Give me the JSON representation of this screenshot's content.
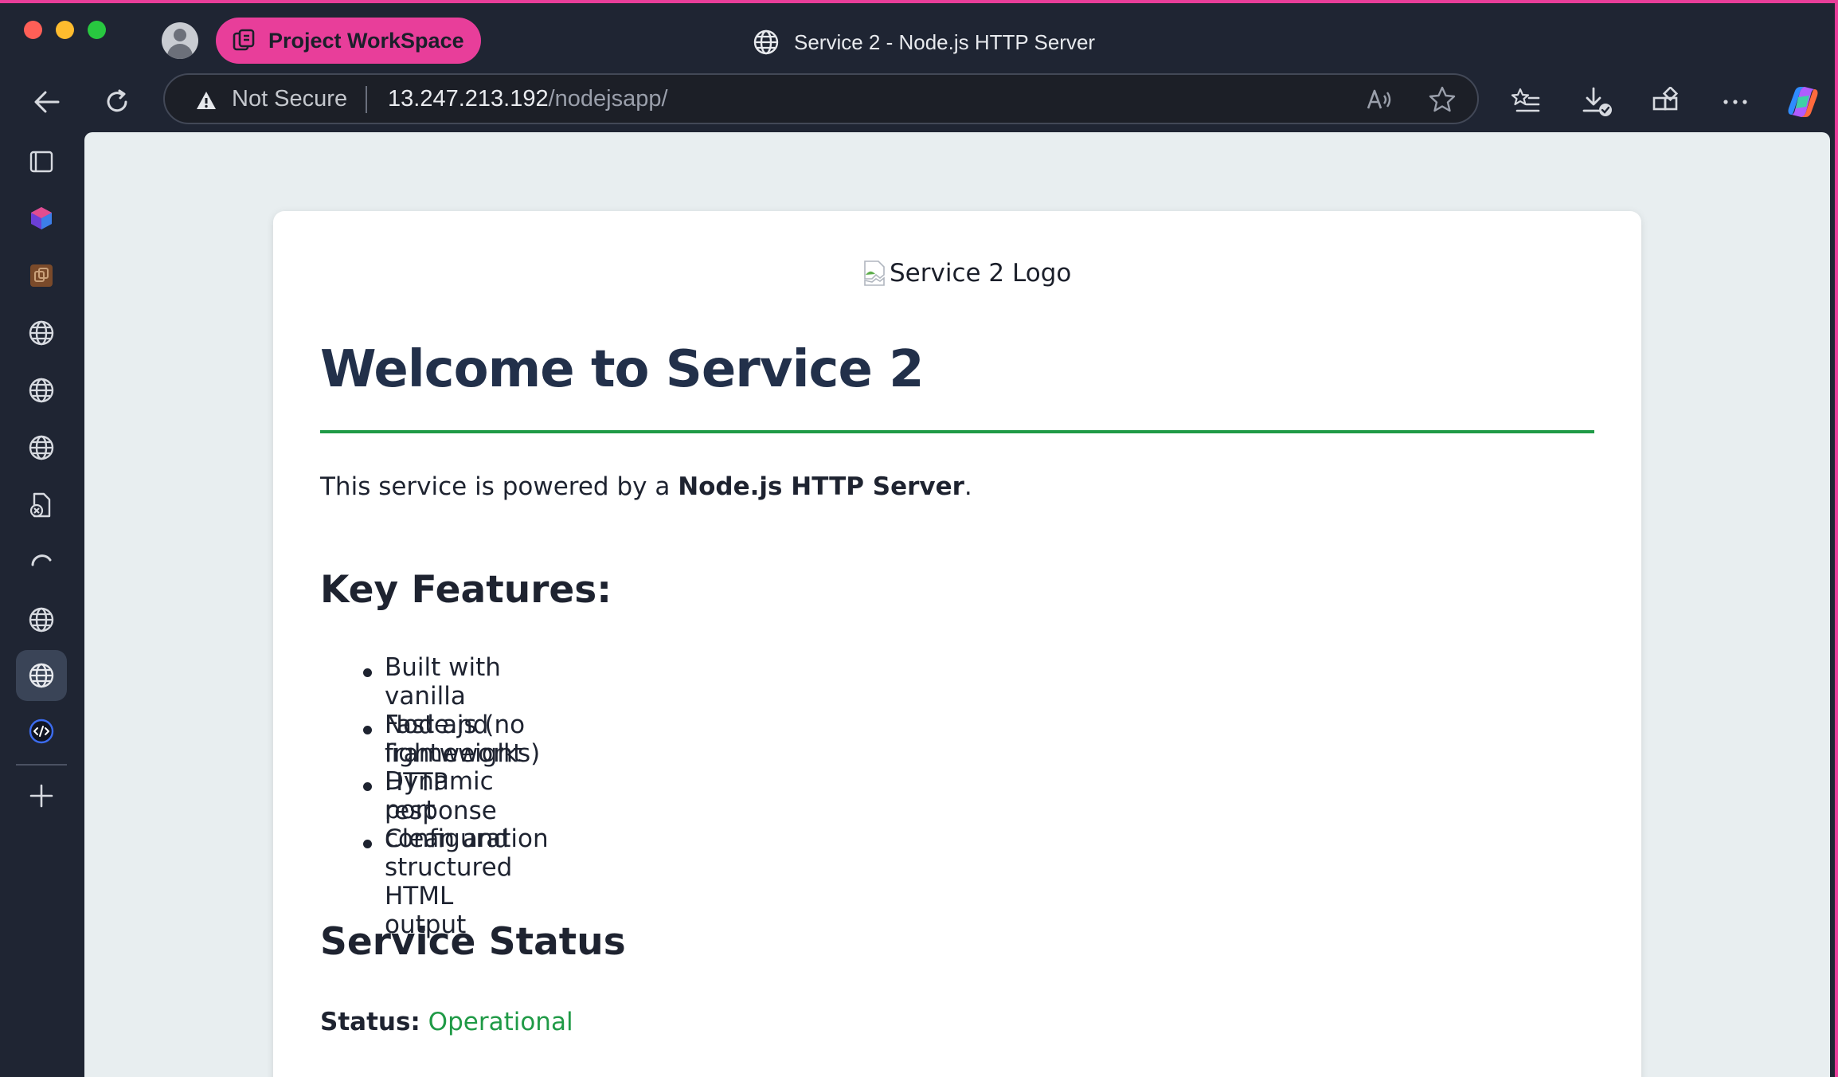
{
  "browser": {
    "workspace_label": "Project WorkSpace",
    "tab_title": "Service 2 - Node.js HTTP Server",
    "address": {
      "security_label": "Not Secure",
      "host": "13.247.213.192",
      "path": "/nodejsapp/"
    },
    "frame_accent": "#e83e9a"
  },
  "page": {
    "logo_alt": "Service 2 Logo",
    "heading": "Welcome to Service 2",
    "intro_prefix": "This service is powered by a ",
    "intro_strong": "Node.js HTTP Server",
    "intro_suffix": ".",
    "features_heading": "Key Features:",
    "features": [
      "Built with vanilla Node.js (no frameworks)",
      "Fast and lightweight HTTP response",
      "Dynamic port configuration",
      "Clean and structured HTML output"
    ],
    "status_heading": "Service Status",
    "status_label": "Status:",
    "status_value": "Operational",
    "accent_color": "#1f9a46"
  }
}
